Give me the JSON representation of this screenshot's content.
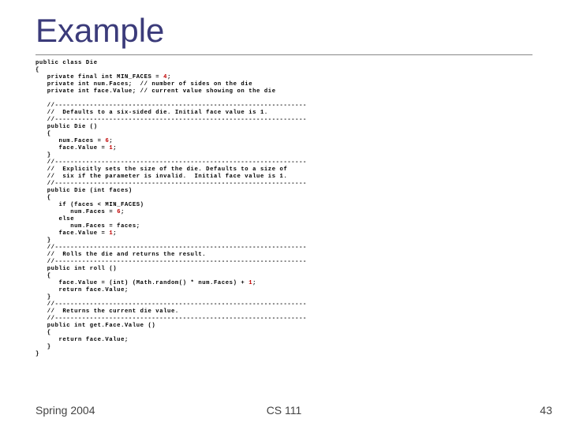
{
  "title": "Example",
  "code_lines": [
    "public class Die",
    "{",
    "   private final int MIN_FACES = |4|;",
    "   private int num.Faces;  // number of sides on the die",
    "   private int face.Value; // current value showing on the die",
    "",
    "   //-----------------------------------------------------------------",
    "   //  Defaults to a six-sided die. Initial face value is 1.",
    "   //-----------------------------------------------------------------",
    "   public Die ()",
    "   {",
    "      num.Faces = |6|;",
    "      face.Value = |1|;",
    "   }",
    "   //-----------------------------------------------------------------",
    "   //  Explicitly sets the size of the die. Defaults to a size of",
    "   //  six if the parameter is invalid.  Initial face value is 1.",
    "   //-----------------------------------------------------------------",
    "   public Die (int faces)",
    "   {",
    "      if (faces < MIN_FACES)",
    "         num.Faces = |6|;",
    "      else",
    "         num.Faces = faces;",
    "      face.Value = |1|;",
    "   }",
    "   //-----------------------------------------------------------------",
    "   //  Rolls the die and returns the result.",
    "   //-----------------------------------------------------------------",
    "   public int roll ()",
    "   {",
    "      face.Value = (int) (Math.random() * num.Faces) + |1|;",
    "      return face.Value;",
    "   }",
    "   //-----------------------------------------------------------------",
    "   //  Returns the current die value.",
    "   //-----------------------------------------------------------------",
    "   public int get.Face.Value ()",
    "   {",
    "      return face.Value;",
    "   }",
    "}"
  ],
  "footer": {
    "left": "Spring 2004",
    "center": "CS 111",
    "right": "43"
  }
}
